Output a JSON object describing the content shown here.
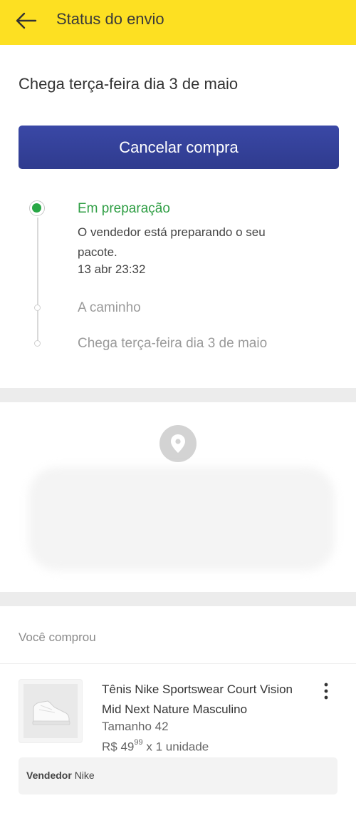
{
  "header": {
    "title": "Status do envio",
    "back_icon": "arrow-left-icon"
  },
  "shipment": {
    "eta": "Chega terça-feira dia 3 de maio",
    "cancel_label": "Cancelar compra",
    "steps": [
      {
        "title": "Em preparação",
        "description": "O vendedor está preparando o seu pacote.",
        "time": "13 abr 23:32",
        "status": "active"
      },
      {
        "title": "A caminho",
        "status": "pending"
      },
      {
        "title": "Chega terça-feira dia 3 de maio",
        "status": "pending"
      }
    ]
  },
  "address": {
    "icon": "location-pin-icon"
  },
  "purchase": {
    "section_label": "Você comprou",
    "product": {
      "title": "Tênis Nike Sportswear Court Vision Mid Next Nature Masculino",
      "size": "Tamanho 42",
      "price_main": "R$ 49",
      "price_cents": "99",
      "quantity": "x 1 unidade"
    },
    "seller_label": "Vendedor",
    "seller_name": "Nike"
  },
  "colors": {
    "header_bg": "#fde022",
    "primary": "#3340a0",
    "success": "#2f9e44"
  }
}
